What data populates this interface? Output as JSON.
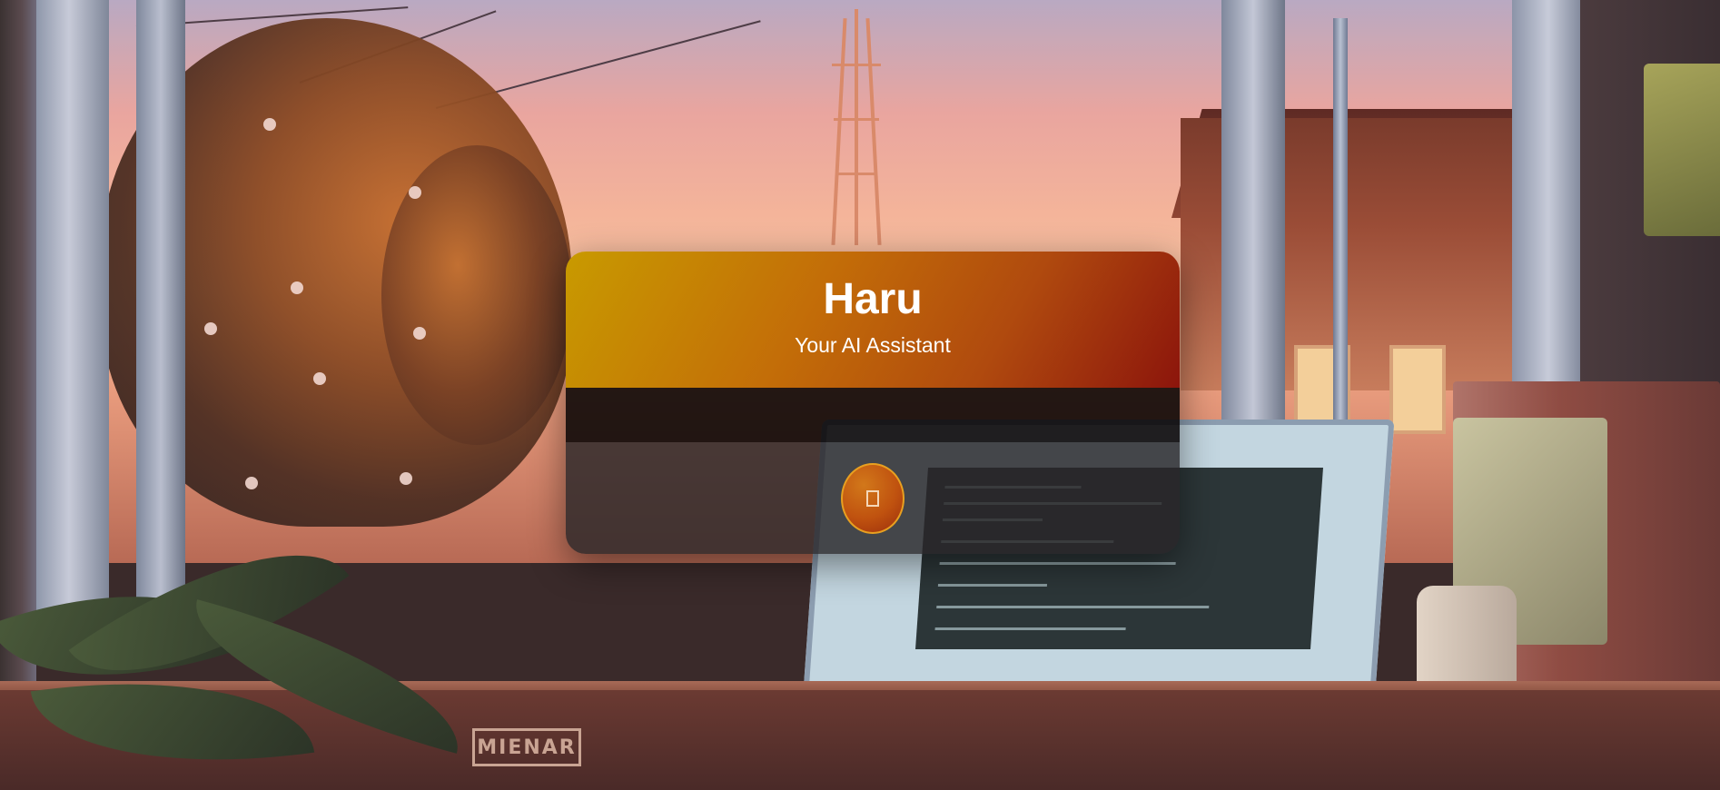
{
  "app": {
    "title": "Haru",
    "subtitle": "Your AI Assistant"
  },
  "background": {
    "desk_label": "MIENAR"
  },
  "colors": {
    "header_gradient_start": "#c89a00",
    "header_gradient_end": "#8c150c",
    "mic_button": "#c0520f",
    "messages_area": "#080404",
    "footer_area": "#282628"
  },
  "controls": {
    "mic_button_icon": "microphone-icon"
  }
}
